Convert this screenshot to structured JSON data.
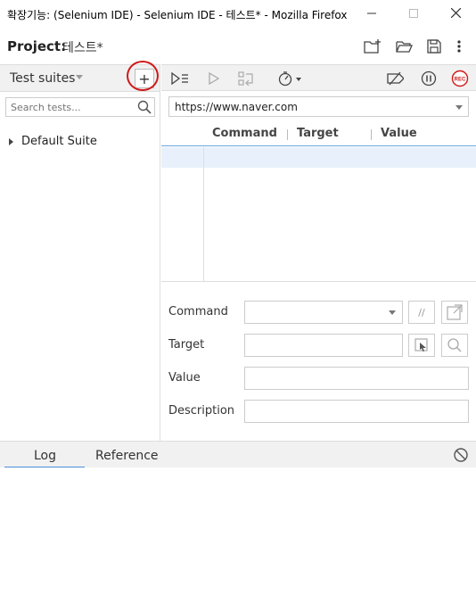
{
  "window": {
    "title": "확장기능: (Selenium IDE) - Selenium IDE - 테스트* - Mozilla Firefox",
    "minimize_icon": "minimize-icon",
    "maximize_icon": "maximize-icon",
    "close_icon": "close-icon"
  },
  "project": {
    "label": "Project:",
    "name": "테스트*",
    "actions": [
      "new-project-icon",
      "open-project-icon",
      "save-project-icon",
      "more-options-icon"
    ]
  },
  "sidebar": {
    "header_label": "Test suites",
    "add_label": "+",
    "search_placeholder": "Search tests...",
    "suites": [
      {
        "name": "Default Suite"
      }
    ]
  },
  "toolbar": {
    "icons": [
      "run-all-tests-icon",
      "run-current-test-icon",
      "step-over-icon",
      "test-speed-icon",
      "disable-breakpoints-icon",
      "pause-on-exceptions-icon",
      "record-icon"
    ],
    "record_label": "REC"
  },
  "base_url": "https://www.naver.com",
  "table": {
    "columns": [
      "Command",
      "Target",
      "Value"
    ]
  },
  "editor": {
    "command_label": "Command",
    "target_label": "Target",
    "value_label": "Value",
    "description_label": "Description",
    "comment_label": "//"
  },
  "bottom": {
    "tabs": [
      "Log",
      "Reference"
    ],
    "active_tab": "Log"
  },
  "colors": {
    "accent": "#4a90d9",
    "record": "#d01818",
    "highlight_circle": "#d01818"
  }
}
